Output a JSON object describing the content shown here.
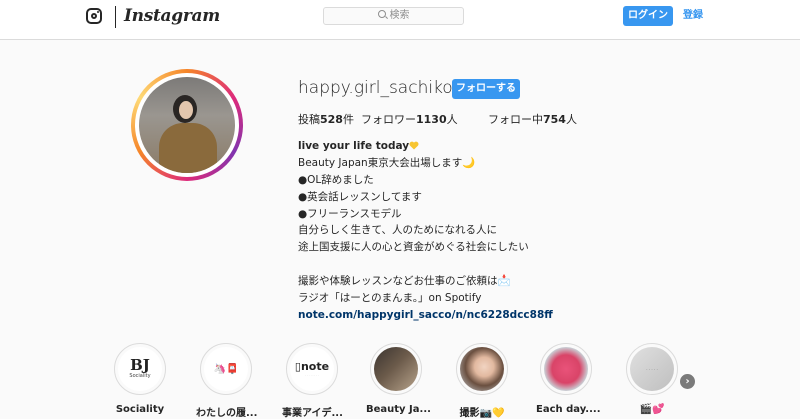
{
  "header": {
    "logo_icon": "instagram-camera-icon",
    "wordmark": "Instagram",
    "search_placeholder": "検索",
    "login_label": "ログイン",
    "signup_label": "登録",
    "accent_color": "#3897f0"
  },
  "profile": {
    "username": "happy.girl_sachiko",
    "follow_label": "フォローする",
    "stats": [
      {
        "prefix": "投稿",
        "count": "528",
        "suffix": "件"
      },
      {
        "prefix": "フォロワー",
        "count": "1130",
        "suffix": "人"
      },
      {
        "prefix": "フォロー中",
        "count": "754",
        "suffix": "人"
      }
    ],
    "bio": {
      "name": "live your life today",
      "lines": [
        "Beauty Japan東京大会出場します🌙",
        "●OL辞めました",
        "●英会話レッスンしてます",
        "●フリーランスモデル",
        "自分らしく生きて、人のためになれる人に",
        "途上国支援に人の心と資金がめぐる社会にしたい",
        "",
        "撮影や体験レッスンなどお仕事のご依頼は📩",
        "ラジオ「はーとのまんま。」on Spotify"
      ],
      "link": "note.com/happygirl_sacco/n/nc6228dcc88ff"
    }
  },
  "highlights": [
    {
      "label": "Sociality",
      "cover": "BJ Sociality"
    },
    {
      "label": "わたしの履...",
      "cover": "emoji-icons"
    },
    {
      "label": "事業アイデ...",
      "cover": "note"
    },
    {
      "label": "Beauty Ja...",
      "cover": "photo"
    },
    {
      "label": "撮影📷💛",
      "cover": "photo"
    },
    {
      "label": "Each day....",
      "cover": "photo"
    },
    {
      "label": "🎬💕",
      "cover": "photo"
    }
  ]
}
